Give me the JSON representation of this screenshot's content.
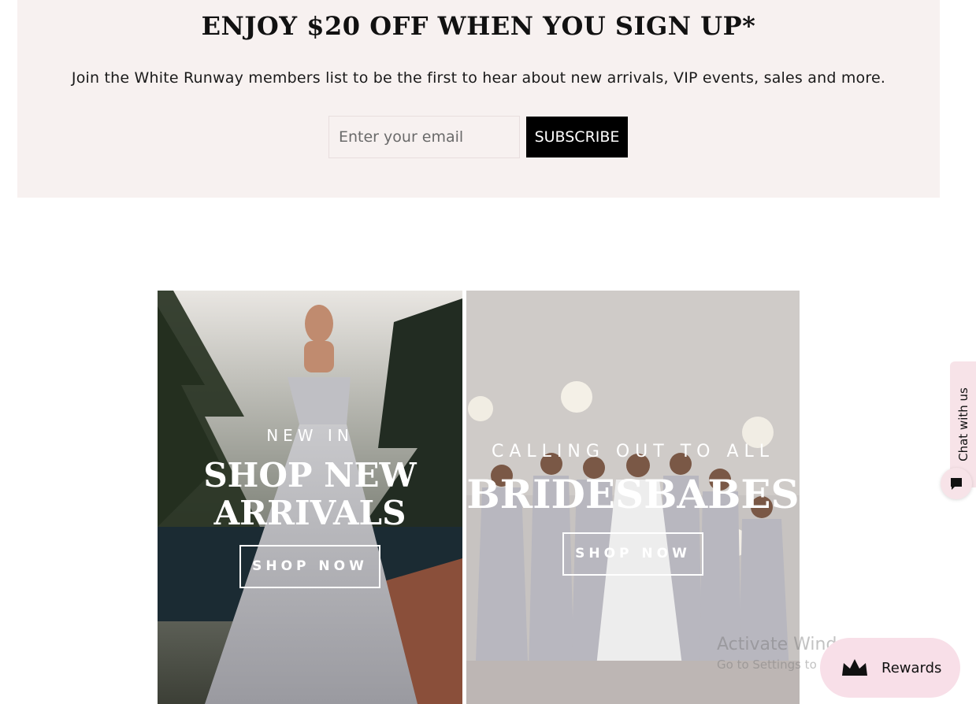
{
  "signup": {
    "title": "ENJOY $20 OFF WHEN YOU SIGN UP*",
    "subtitle": "Join the White Runway members list to be the first to hear about new arrivals, VIP events, sales and more.",
    "email_placeholder": "Enter your email",
    "subscribe_label": "SUBSCRIBE"
  },
  "cards": [
    {
      "eyebrow": "NEW IN",
      "headline_line1": "SHOP NEW",
      "headline_line2": "ARRIVALS",
      "button_label": "SHOP NOW"
    },
    {
      "eyebrow": "CALLING OUT TO ALL",
      "headline": "BRIDESBABES",
      "button_label": "SHOP NOW"
    }
  ],
  "chat": {
    "tab_label": "Chat with us",
    "icon": "chat-bubble-icon"
  },
  "rewards": {
    "label": "Rewards",
    "icon": "crown-icon"
  },
  "watermark": {
    "title": "Activate Windows",
    "subtitle": "Go to Settings to activate Windows."
  },
  "colors": {
    "band": "#f7f1f0",
    "button": "#000000",
    "rewards_bg": "#f8dfe8",
    "chat_bg": "#f7e3e8"
  }
}
